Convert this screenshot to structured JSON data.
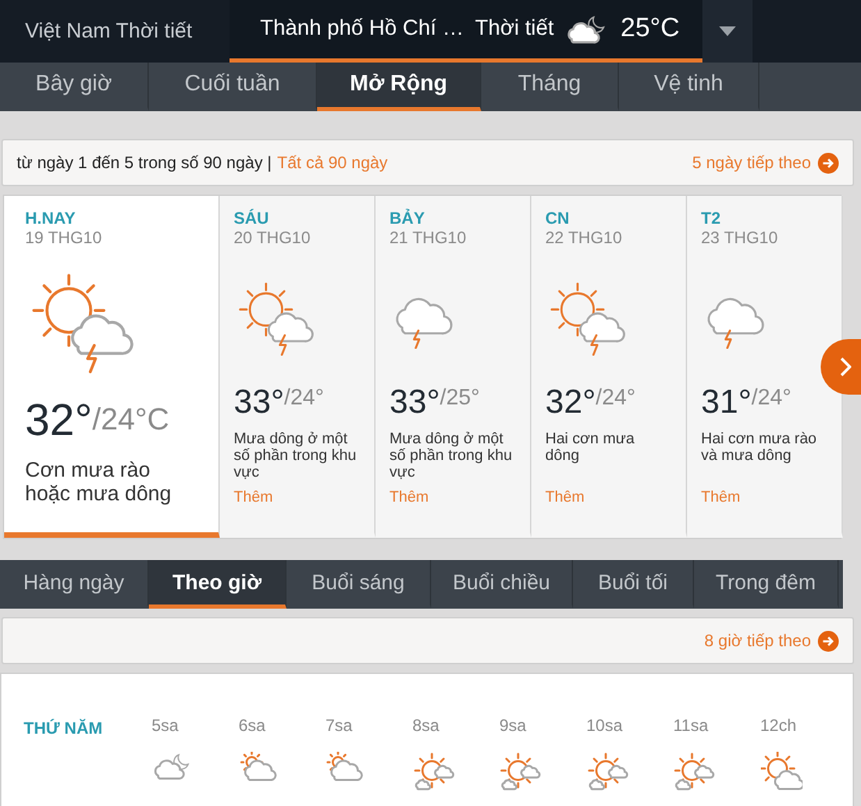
{
  "header": {
    "site_title": "Việt Nam Thời tiết",
    "location": "Thành phố Hồ Chí …",
    "weather_label": "Thời tiết",
    "current_temp": "25°C"
  },
  "nav_tabs": [
    {
      "label": "Bây giờ",
      "selected": false
    },
    {
      "label": "Cuối tuần",
      "selected": false
    },
    {
      "label": "Mở Rộng",
      "selected": true
    },
    {
      "label": "Tháng",
      "selected": false
    },
    {
      "label": "Vệ tinh",
      "selected": false
    }
  ],
  "range_bar": {
    "summary": "từ ngày 1 đến 5 trong số 90 ngày |",
    "all_link": "Tất cả 90 ngày",
    "next_link": "5 ngày tiếp theo"
  },
  "days": [
    {
      "day": "H.NAY",
      "date": "19 THG10",
      "kind": "sunstorm",
      "high": "32°",
      "low": "/24°C",
      "description": "Cơn mưa rào hoặc mưa dông",
      "selected": true
    },
    {
      "day": "SÁU",
      "date": "20 THG10",
      "kind": "sunstorm",
      "high": "33°",
      "low": "/24°",
      "description": "Mưa dông ở một số phần trong khu vực",
      "more": "Thêm",
      "selected": false
    },
    {
      "day": "BẢY",
      "date": "21 THG10",
      "kind": "storm",
      "high": "33°",
      "low": "/25°",
      "description": "Mưa dông ở một số phần trong khu vực",
      "more": "Thêm",
      "selected": false
    },
    {
      "day": "CN",
      "date": "22 THG10",
      "kind": "sunstorm",
      "high": "32°",
      "low": "/24°",
      "description": "Hai cơn mưa dông",
      "more": "Thêm",
      "selected": false
    },
    {
      "day": "T2",
      "date": "23 THG10",
      "kind": "storm",
      "high": "31°",
      "low": "/24°",
      "description": "Hai cơn mưa rào và mưa dông",
      "more": "Thêm",
      "selected": false
    }
  ],
  "period_tabs": [
    {
      "label": "Hàng ngày",
      "selected": false
    },
    {
      "label": "Theo giờ",
      "selected": true
    },
    {
      "label": "Buổi sáng",
      "selected": false
    },
    {
      "label": "Buổi chiều",
      "selected": false
    },
    {
      "label": "Buổi tối",
      "selected": false
    },
    {
      "label": "Trong đêm",
      "selected": false
    }
  ],
  "hours_bar": {
    "next_link": "8 giờ tiếp theo"
  },
  "hourly": {
    "day_label": "THỨ NĂM",
    "hours": [
      {
        "time": "5sa",
        "kind": "night"
      },
      {
        "time": "6sa",
        "kind": "dawn"
      },
      {
        "time": "7sa",
        "kind": "dawn"
      },
      {
        "time": "8sa",
        "kind": "sunny"
      },
      {
        "time": "9sa",
        "kind": "sunny"
      },
      {
        "time": "10sa",
        "kind": "sunny"
      },
      {
        "time": "11sa",
        "kind": "sunny"
      },
      {
        "time": "12ch",
        "kind": "cloudy"
      }
    ]
  }
}
